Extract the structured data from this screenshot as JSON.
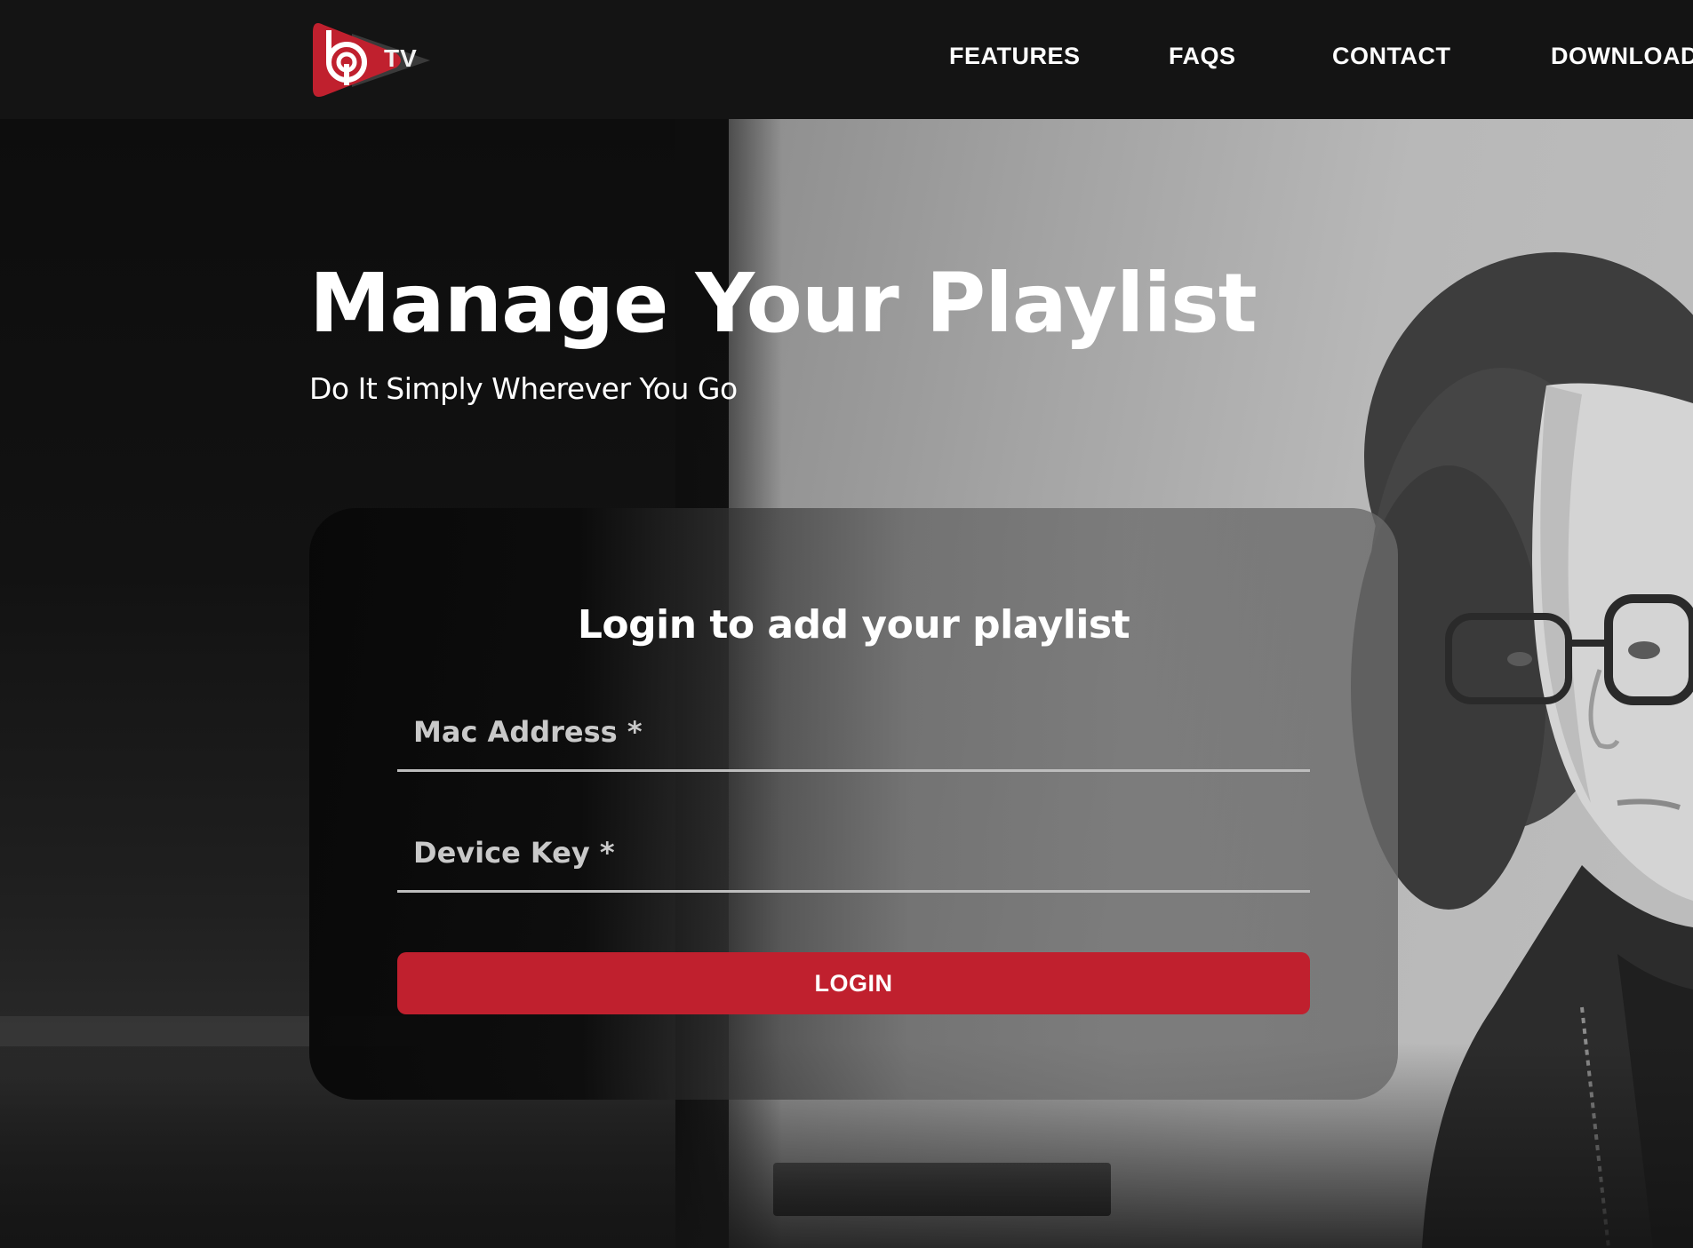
{
  "brand": {
    "logo_text": "TV",
    "accent_color": "#c0202e"
  },
  "nav": {
    "items": [
      {
        "label": "FEATURES"
      },
      {
        "label": "FAQS"
      },
      {
        "label": "CONTACT"
      },
      {
        "label": "DOWNLOAD"
      }
    ]
  },
  "hero": {
    "title": "Manage Your Playlist",
    "subtitle": "Do It Simply Wherever You Go"
  },
  "login": {
    "heading": "Login to add your playlist",
    "mac_address": {
      "placeholder": "Mac Address *",
      "value": ""
    },
    "device_key": {
      "placeholder": "Device Key *",
      "value": ""
    },
    "button_label": "LOGIN"
  },
  "icons": {
    "logo_icon": "play-button-logo-icon"
  }
}
